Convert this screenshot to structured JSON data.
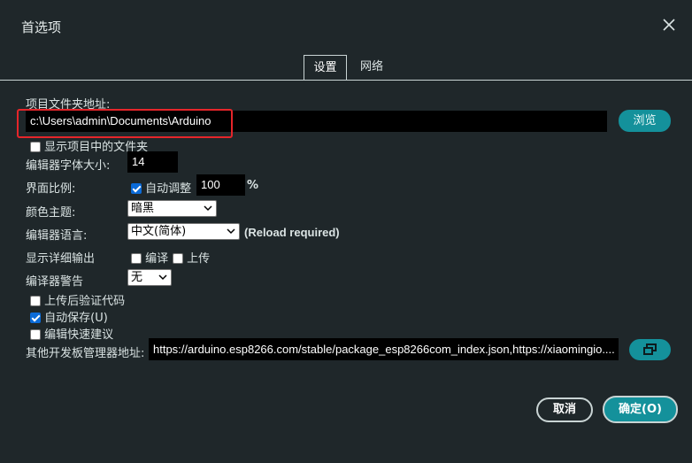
{
  "dialog": {
    "title": "首选项"
  },
  "tabs": [
    {
      "label": "设置"
    },
    {
      "label": "网络"
    }
  ],
  "settings": {
    "sketchbook_label": "项目文件夹地址:",
    "sketchbook_path": "c:\\Users\\admin\\Documents\\Arduino",
    "browse_label": "浏览",
    "show_files_label": "显示项目中的文件夹",
    "show_files_checked": false,
    "font_size_label": "编辑器字体大小:",
    "font_size_value": "14",
    "scale_label": "界面比例:",
    "auto_scale_label": "自动调整",
    "auto_scale_checked": true,
    "scale_value": "100",
    "scale_unit": "%",
    "theme_label": "颜色主题:",
    "theme_value": "暗黑",
    "language_label": "编辑器语言:",
    "language_value": "中文(简体)",
    "language_note": "(Reload required)",
    "verbose_label": "显示详细输出",
    "verbose_compile_label": "编译",
    "verbose_compile_checked": false,
    "verbose_upload_label": "上传",
    "verbose_upload_checked": false,
    "warnings_label": "编译器警告",
    "warnings_value": "无",
    "verify_after_upload_label": "上传后验证代码",
    "verify_after_upload_checked": false,
    "autosave_label": "自动保存(U)",
    "autosave_checked": true,
    "quick_suggestions_label": "编辑快速建议",
    "quick_suggestions_checked": false,
    "board_urls_label": "其他开发板管理器地址:",
    "board_urls_value": "https://arduino.esp8266.com/stable/package_esp8266com_index.json,https://xiaomingio...."
  },
  "footer": {
    "cancel_label": "取消",
    "ok_label": "确定(O)"
  },
  "colors": {
    "background": "#1f272a",
    "accent": "#14919b",
    "highlight_outline": "#e5252a"
  }
}
